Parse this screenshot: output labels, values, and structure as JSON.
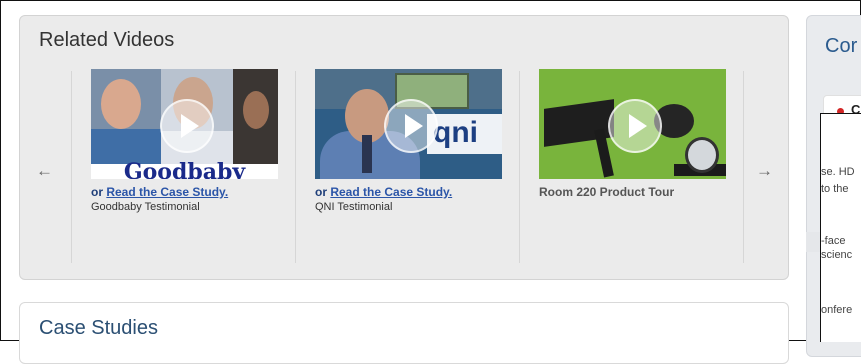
{
  "related_videos": {
    "title": "Related Videos",
    "prev_arrow": "←",
    "next_arrow": "→",
    "videos": [
      {
        "thumb_brand": "Goodbaby",
        "case_prefix": "or ",
        "case_link": "Read the Case Study.",
        "title": "Goodbaby Testimonial"
      },
      {
        "thumb_brand": "qni",
        "case_prefix": "or ",
        "case_link": "Read the Case Study.",
        "title": "QNI Testimonial"
      },
      {
        "title": "Room 220 Product Tour"
      }
    ]
  },
  "case_studies": {
    "title": "Case Studies"
  },
  "right_panel": {
    "title": "Cor",
    "tab_label": "C",
    "snippets": [
      "se. HD",
      " to the",
      "-face",
      "scienc",
      "onfere"
    ]
  },
  "colors": {
    "link": "#2b55a8",
    "heading": "#2b4f73",
    "bullet": "#d32626"
  }
}
